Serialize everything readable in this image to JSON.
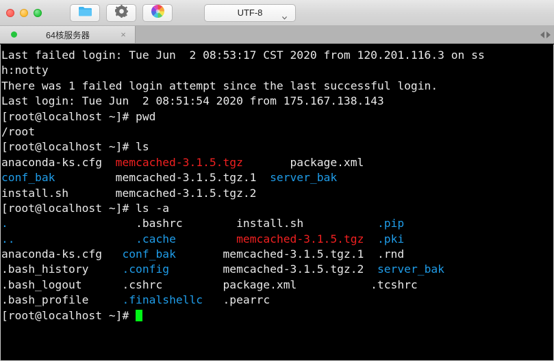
{
  "window": {
    "traffic_lights": [
      {
        "name": "close",
        "color": "#fe5f57"
      },
      {
        "name": "minimize",
        "color": "#febc2e"
      },
      {
        "name": "maximize",
        "color": "#28c840"
      }
    ],
    "toolbar": [
      {
        "icon": "folder-icon",
        "label": "Folder"
      },
      {
        "icon": "gear-icon",
        "label": "Settings"
      },
      {
        "icon": "color-wheel-icon",
        "label": "Appearance"
      }
    ],
    "encoding": {
      "label": "UTF-8",
      "chevron": "chevron-down-icon"
    }
  },
  "tabs": [
    {
      "title": "64核服务器",
      "status": "connected",
      "status_color": "#25c53d",
      "close_glyph": "×"
    }
  ],
  "tab_nav": {
    "prev": "◀",
    "next": "▶"
  },
  "terminal": {
    "colors": {
      "background": "#000000",
      "foreground": "#e9e9e9",
      "red": "#f02020",
      "blue": "#1f9ce8",
      "cursor": "#00f516"
    },
    "lines": [
      [
        {
          "t": "Last failed login: Tue Jun  2 08:53:17 CST 2020 from 120.201.116.3 on ss",
          "c": "white"
        }
      ],
      [
        {
          "t": "h:notty",
          "c": "white"
        }
      ],
      [
        {
          "t": "There was 1 failed login attempt since the last successful login.",
          "c": "white"
        }
      ],
      [
        {
          "t": "Last login: Tue Jun  2 08:51:54 2020 from 175.167.138.143",
          "c": "white"
        }
      ],
      [
        {
          "t": "[root@localhost ~]# pwd",
          "c": "white"
        }
      ],
      [
        {
          "t": "/root",
          "c": "white"
        }
      ],
      [
        {
          "t": "[root@localhost ~]# ls",
          "c": "white"
        }
      ],
      [
        {
          "t": "anaconda-ks.cfg  ",
          "c": "white"
        },
        {
          "t": "memcached-3.1.5.tgz",
          "c": "red"
        },
        {
          "t": "       package.xml",
          "c": "white"
        }
      ],
      [
        {
          "t": "conf_bak",
          "c": "blue"
        },
        {
          "t": "         memcached-3.1.5.tgz.1  ",
          "c": "white"
        },
        {
          "t": "server_bak",
          "c": "blue"
        }
      ],
      [
        {
          "t": "install.sh       memcached-3.1.5.tgz.2",
          "c": "white"
        }
      ],
      [
        {
          "t": "[root@localhost ~]# ls -a",
          "c": "white"
        }
      ],
      [
        {
          "t": ".",
          "c": "blue"
        },
        {
          "t": "                   ",
          "c": "white"
        },
        {
          "t": ".bashrc        install.sh           ",
          "c": "white"
        },
        {
          "t": ".pip",
          "c": "blue"
        }
      ],
      [
        {
          "t": "..",
          "c": "blue"
        },
        {
          "t": "                  ",
          "c": "white"
        },
        {
          "t": ".cache",
          "c": "blue"
        },
        {
          "t": "         ",
          "c": "white"
        },
        {
          "t": "memcached-3.1.5.tgz",
          "c": "red"
        },
        {
          "t": "  ",
          "c": "white"
        },
        {
          "t": ".pki",
          "c": "blue"
        }
      ],
      [
        {
          "t": "anaconda-ks.cfg   ",
          "c": "white"
        },
        {
          "t": "conf_bak",
          "c": "blue"
        },
        {
          "t": "       memcached-3.1.5.tgz.1  .rnd",
          "c": "white"
        }
      ],
      [
        {
          "t": ".bash_history     ",
          "c": "white"
        },
        {
          "t": ".config",
          "c": "blue"
        },
        {
          "t": "        memcached-3.1.5.tgz.2  ",
          "c": "white"
        },
        {
          "t": "server_bak",
          "c": "blue"
        }
      ],
      [
        {
          "t": ".bash_logout      .cshrc         package.xml           .tcshrc",
          "c": "white"
        }
      ],
      [
        {
          "t": ".bash_profile     ",
          "c": "white"
        },
        {
          "t": ".finalshellc",
          "c": "blue"
        },
        {
          "t": "   .pearrc",
          "c": "white"
        }
      ],
      [
        {
          "t": "[root@localhost ~]# ",
          "c": "white",
          "cursor": true
        }
      ]
    ]
  }
}
